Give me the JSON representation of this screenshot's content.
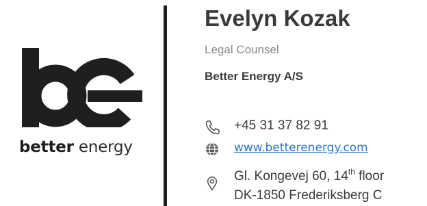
{
  "logo": {
    "word_part1": "better",
    "word_part2": " energy"
  },
  "contact": {
    "name": "Evelyn Kozak",
    "title": "Legal Counsel",
    "company": "Better Energy A/S",
    "phone": "+45 31 37 82 91",
    "website": "www.betterenergy.com",
    "address": {
      "line1_prefix": "Gl. Kongevej 60, 14",
      "line1_sup": "th",
      "line1_suffix": " floor",
      "line2": "DK-1850  Frederiksberg C"
    }
  },
  "icons": {
    "phone": "phone-icon",
    "web": "globe-icon",
    "address": "location-pin-icon"
  },
  "colors": {
    "text_dark": "#3a3a3a",
    "text_muted": "#8a8a8a",
    "link": "#2e76c9",
    "divider": "#1e1e1e"
  }
}
